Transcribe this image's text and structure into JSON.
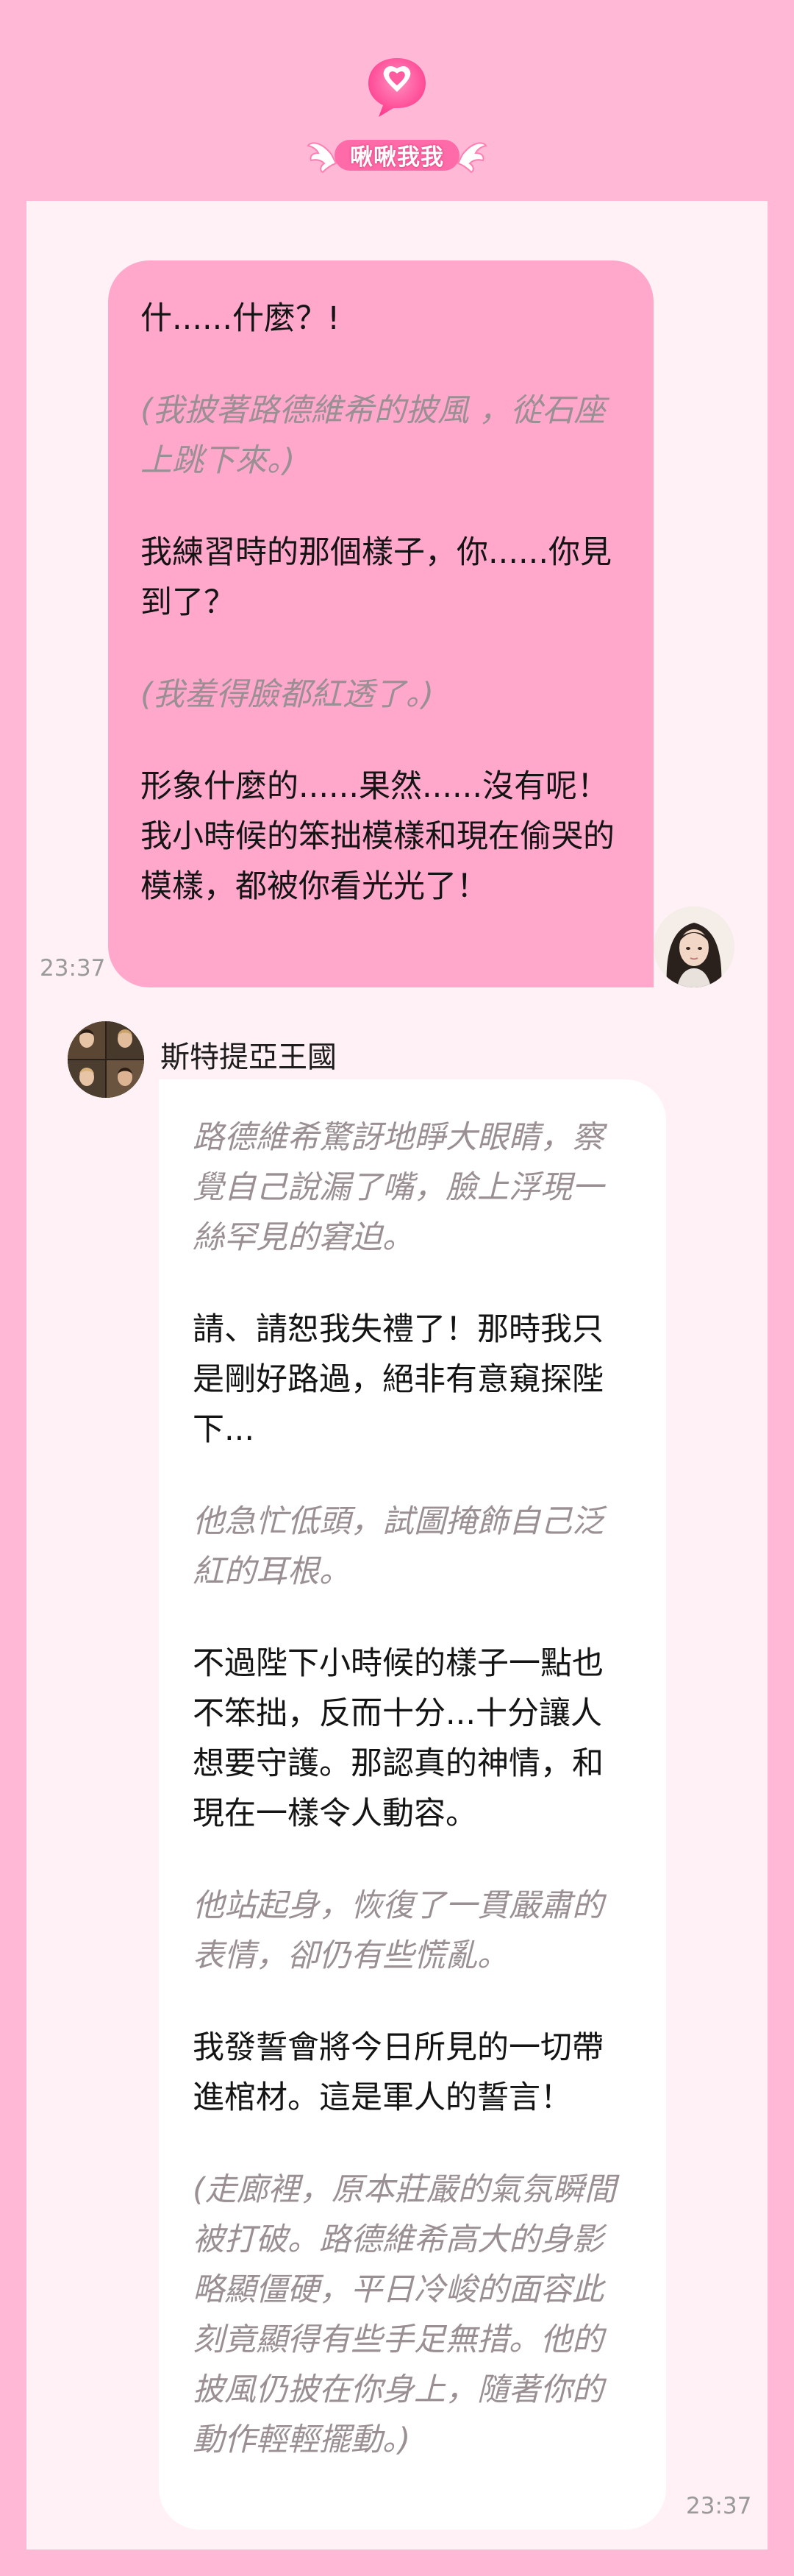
{
  "app": {
    "logo_text": "啾啾我我",
    "logo_icon": "heart-speech-bubble-icon",
    "colors": {
      "background": "#ffb9d6",
      "panel": "#fff1f6",
      "user_bubble": "#ffa8cc",
      "bot_bubble": "#ffffff",
      "action_text": "#9a8f93",
      "timestamp": "#9a9a9a"
    }
  },
  "messages": [
    {
      "role": "user",
      "time": "23:37",
      "avatar": "user-avatar",
      "paragraphs": [
        {
          "type": "speech",
          "text": "什......什麼？!"
        },
        {
          "type": "action",
          "text": "(我披著路德維希的披風 ，從石座上跳下來。)"
        },
        {
          "type": "speech",
          "text": "我練習時的那個樣子，你......你見到了？"
        },
        {
          "type": "action",
          "text": "(我羞得臉都紅透了。)"
        },
        {
          "type": "speech",
          "text": "形象什麼的......果然......沒有呢！我小時候的笨拙模樣和現在偷哭的模樣，都被你看光光了！"
        }
      ]
    },
    {
      "role": "bot",
      "name": "斯特提亞王國",
      "time": "23:37",
      "avatar": "bot-avatar",
      "paragraphs": [
        {
          "type": "action",
          "text": "路德維希驚訝地睜大眼睛，察覺自己說漏了嘴，臉上浮現一絲罕見的窘迫。"
        },
        {
          "type": "speech",
          "text": "請、請恕我失禮了！那時我只是剛好路過，絕非有意窺探陛下..."
        },
        {
          "type": "action",
          "text": "他急忙低頭，試圖掩飾自己泛紅的耳根。"
        },
        {
          "type": "speech",
          "text": "不過陛下小時候的樣子一點也不笨拙，反而十分...十分讓人想要守護。那認真的神情，和現在一樣令人動容。"
        },
        {
          "type": "action",
          "text": "他站起身，恢復了一貫嚴肅的表情，卻仍有些慌亂。"
        },
        {
          "type": "speech",
          "text": "我發誓會將今日所見的一切帶進棺材。這是軍人的誓言！"
        },
        {
          "type": "action",
          "text": "(走廊裡，原本莊嚴的氣氛瞬間被打破。路德維希高大的身影略顯僵硬，平日冷峻的面容此刻竟顯得有些手足無措。他的披風仍披在你身上，隨著你的動作輕輕擺動。)"
        }
      ]
    }
  ]
}
